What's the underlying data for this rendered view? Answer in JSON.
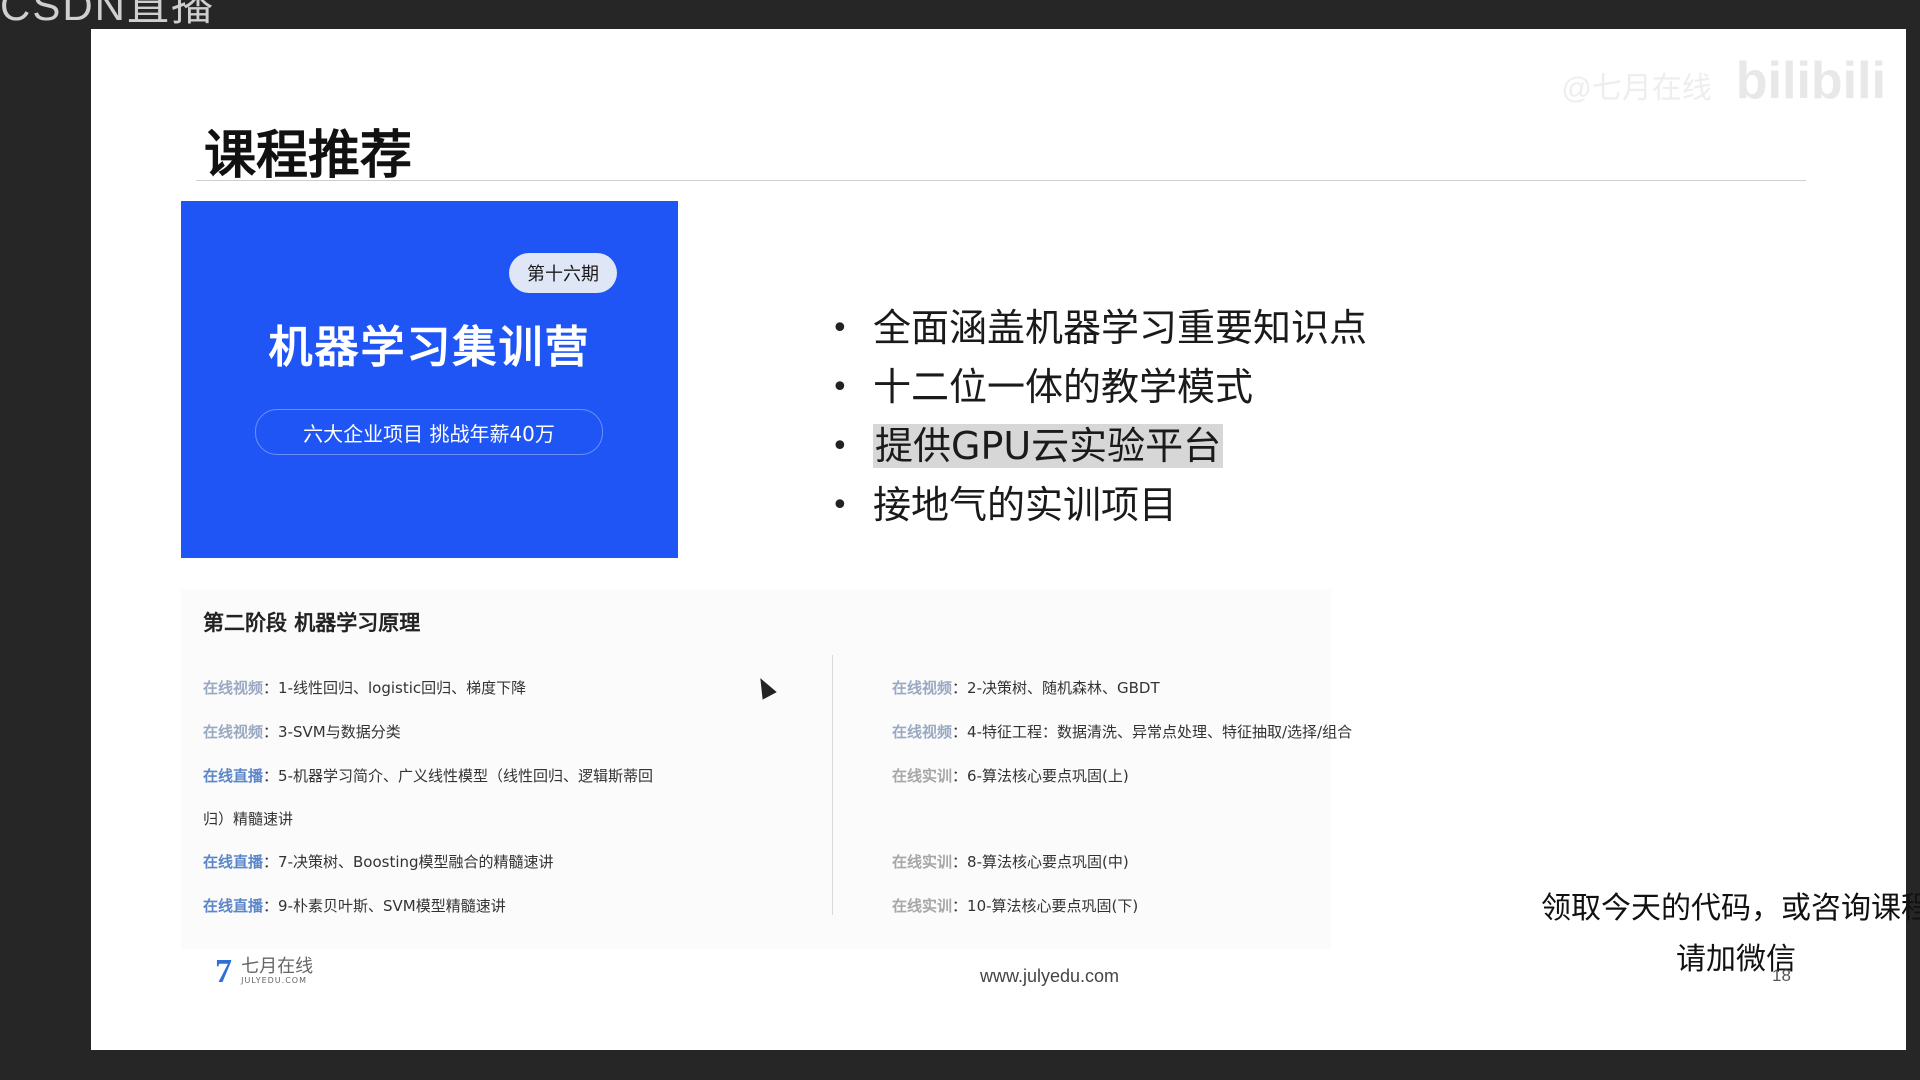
{
  "overlay": {
    "top_logo": "CSDN直播",
    "watermark_small": "@七月在线",
    "watermark": "bilibili"
  },
  "slide": {
    "title": "课程推荐",
    "banner": {
      "badge": "第十六期",
      "title": "机器学习集训营",
      "subtitle": "六大企业项目 挑战年薪40万",
      "bg_color": "#1f55f5"
    },
    "bullets": [
      {
        "text": "全面涵盖机器学习重要知识点",
        "highlighted": false
      },
      {
        "text": "十二位一体的教学模式",
        "highlighted": false
      },
      {
        "text": "提供GPU云实验平台",
        "highlighted": true
      },
      {
        "text": "接地气的实训项目",
        "highlighted": false
      }
    ],
    "stage": {
      "title": "第二阶段 机器学习原理",
      "left": [
        {
          "tag": "在线视频",
          "text": "1-线性回归、logistic回归、梯度下降"
        },
        {
          "tag": "在线视频",
          "text": "3-SVM与数据分类"
        },
        {
          "tag": "在线直播",
          "text": "5-机器学习简介、广义线性模型（线性回归、逻辑斯蒂回"
        },
        {
          "tag": "",
          "text": "归）精髓速讲"
        },
        {
          "tag": "在线直播",
          "text": "7-决策树、Boosting模型融合的精髓速讲"
        },
        {
          "tag": "在线直播",
          "text": "9-朴素贝叶斯、SVM模型精髓速讲"
        }
      ],
      "right": [
        {
          "tag": "在线视频",
          "text": "2-决策树、随机森林、GBDT"
        },
        {
          "tag": "在线视频",
          "text": "4-特征工程：数据清洗、异常点处理、特征抽取/选择/组合"
        },
        {
          "tag": "在线实训",
          "text": "6-算法核心要点巩固(上)"
        },
        {
          "tag": "在线实训",
          "text": "8-算法核心要点巩固(中)"
        },
        {
          "tag": "在线实训",
          "text": "10-算法核心要点巩固(下)"
        }
      ]
    },
    "contact": {
      "line1": "领取今天的代码，或咨询课程",
      "line2": "请加微信"
    },
    "footer": {
      "logo_mark": "7",
      "logo_cn": "七月在线",
      "logo_en": "JULYEDU.COM",
      "url": "www.julyedu.com",
      "page_number": "18"
    }
  }
}
